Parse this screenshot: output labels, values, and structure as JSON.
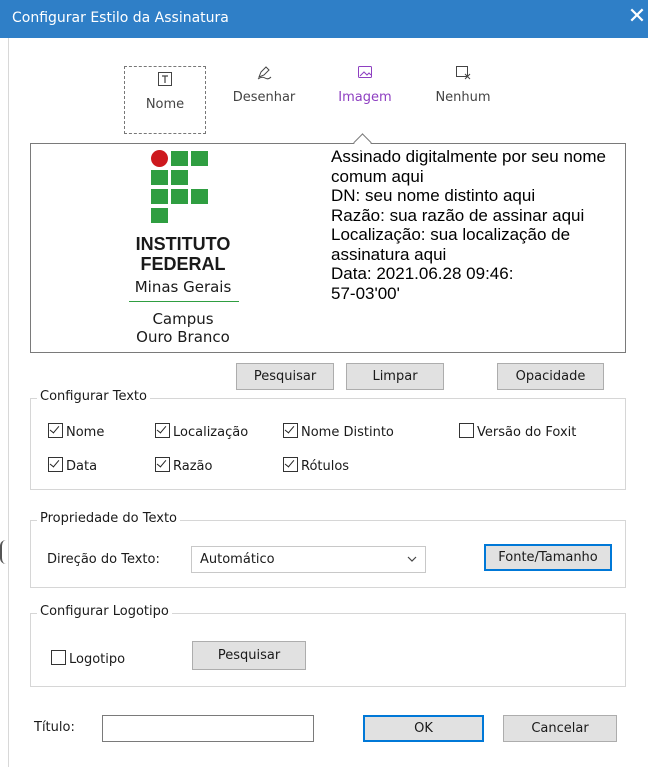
{
  "window": {
    "title": "Configurar Estilo da Assinatura",
    "close_icon": "close-icon"
  },
  "tabs": [
    {
      "label": "Nome",
      "icon": "text-box-icon"
    },
    {
      "label": "Desenhar",
      "icon": "pen-draw-icon"
    },
    {
      "label": "Imagem",
      "icon": "image-icon"
    },
    {
      "label": "Nenhum",
      "icon": "no-signature-icon"
    }
  ],
  "preview": {
    "logo": {
      "line1": "INSTITUTO",
      "line2": "FEDERAL",
      "line3": "Minas Gerais",
      "line4": "Campus",
      "line5": "Ouro Branco"
    },
    "signature_text": "Assinado digitalmente por seu nome comum aqui\nDN: seu nome distinto aqui\nRazão: sua razão de assinar aqui\nLocalização: sua localização de assinatura aqui\nData: 2021.06.28 09:46:\n57-03'00'"
  },
  "image_buttons": {
    "search": "Pesquisar",
    "clear": "Limpar",
    "opacity": "Opacidade"
  },
  "configure_text": {
    "legend": "Configurar Texto",
    "options": [
      {
        "label": "Nome",
        "checked": true
      },
      {
        "label": "Localização",
        "checked": true
      },
      {
        "label": "Nome Distinto",
        "checked": true
      },
      {
        "label": "Versão do Foxit",
        "checked": false
      },
      {
        "label": "Data",
        "checked": true
      },
      {
        "label": "Razão",
        "checked": true
      },
      {
        "label": "Rótulos",
        "checked": true
      }
    ]
  },
  "text_property": {
    "legend": "Propriedade do Texto",
    "direction_label": "Direção do Texto:",
    "direction_value": "Automático",
    "font_button": "Fonte/Tamanho"
  },
  "configure_logo": {
    "legend": "Configurar Logotipo",
    "logo_checkbox": {
      "label": "Logotipo",
      "checked": false
    },
    "search_button": "Pesquisar"
  },
  "footer": {
    "title_label": "Título:",
    "title_value": "",
    "ok": "OK",
    "cancel": "Cancelar"
  },
  "colors": {
    "titlebar": "#2f7fc7",
    "selected_tab": "#8e3fc1",
    "logo_green": "#2f9e41",
    "logo_red": "#cd191e",
    "focus": "#0078d7"
  }
}
